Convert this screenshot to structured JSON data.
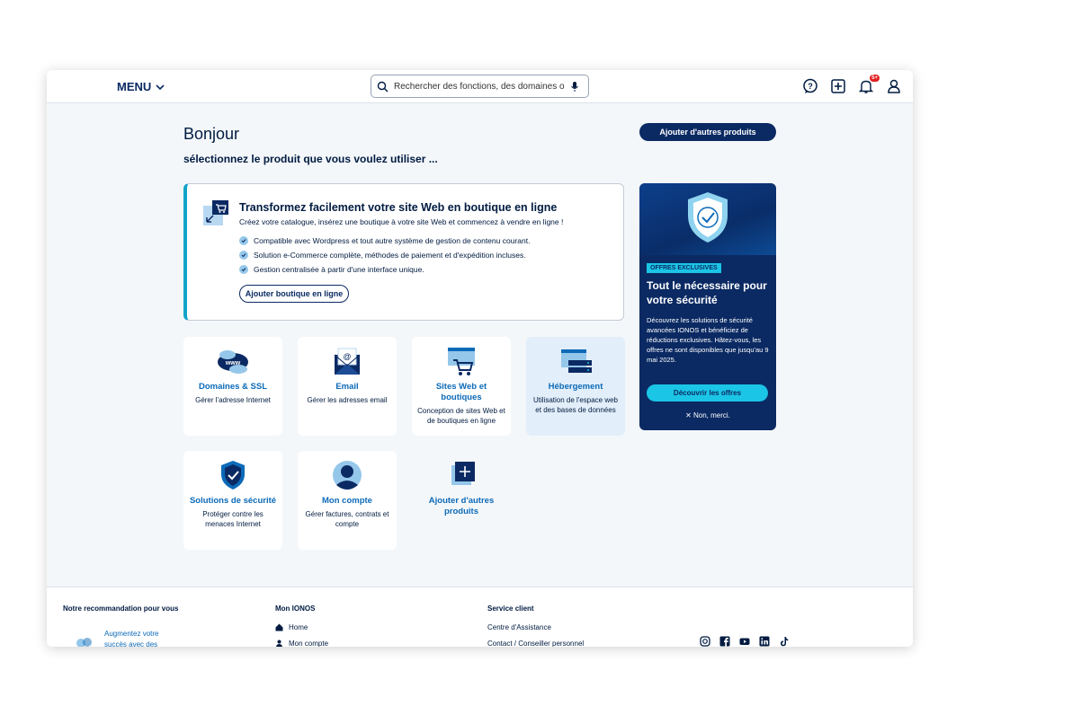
{
  "topbar": {
    "menu_label": "MENU",
    "search_placeholder": "Rechercher des fonctions, des domaines ou ...",
    "notif_count": "5+"
  },
  "header": {
    "greeting": "Bonjour",
    "subtitle": "sélectionnez le produit que vous voulez utiliser ...",
    "add_products_button": "Ajouter d'autres produits"
  },
  "promo": {
    "title": "Transformez facilement votre site Web en boutique en ligne",
    "subtitle": "Créez votre catalogue, insérez une boutique à votre site Web et commencez à vendre en ligne !",
    "features": [
      "Compatible avec Wordpress et tout autre système de gestion de contenu courant.",
      "Solution e-Commerce complète, méthodes de paiement et d'expédition incluses.",
      "Gestion centralisée à partir d'une interface unique."
    ],
    "button": "Ajouter boutique en ligne"
  },
  "tiles": [
    {
      "title": "Domaines & SSL",
      "desc": "Gérer l'adresse Internet"
    },
    {
      "title": "Email",
      "desc": "Gérer les adresses email"
    },
    {
      "title": "Sites Web et boutiques",
      "desc": "Conception de sites Web et de boutiques en ligne"
    },
    {
      "title": "Hébergement",
      "desc": "Utilisation de l'espace web et des bases de données"
    },
    {
      "title": "Solutions de sécurité",
      "desc": "Protéger contre les menaces Internet"
    },
    {
      "title": "Mon compte",
      "desc": "Gérer factures, contrats et compte"
    },
    {
      "title": "Ajouter d'autres produits",
      "desc": ""
    }
  ],
  "sidebar_offer": {
    "label": "OFFRES EXCLUSIVES",
    "title": "Tout le nécessaire pour votre sécurité",
    "description": "Découvrez les solutions de sécurité avancées IONOS et bénéficiez de réductions exclusives. Hâtez-vous, les offres ne sont disponibles que jusqu'au 9 mai 2025.",
    "button": "Découvrir les offres",
    "dismiss": "✕ Non, merci."
  },
  "footer": {
    "recommendation_heading": "Notre recommandation pour vous",
    "recommendation_text": "Augmentez votre succès avec des",
    "mon_ionos_heading": "Mon IONOS",
    "mon_ionos_links": [
      "Home",
      "Mon compte"
    ],
    "service_heading": "Service client",
    "service_links": [
      "Centre d'Assistance",
      "Contact / Conseiller personnel"
    ],
    "social": [
      "instagram-icon",
      "facebook-icon",
      "youtube-icon",
      "linkedin-icon",
      "tiktok-icon"
    ]
  },
  "colors": {
    "brand_dark": "#0b2a63",
    "accent_cyan": "#1bc5e6",
    "link_blue": "#0c6ab8",
    "alert_red": "#e02020"
  }
}
